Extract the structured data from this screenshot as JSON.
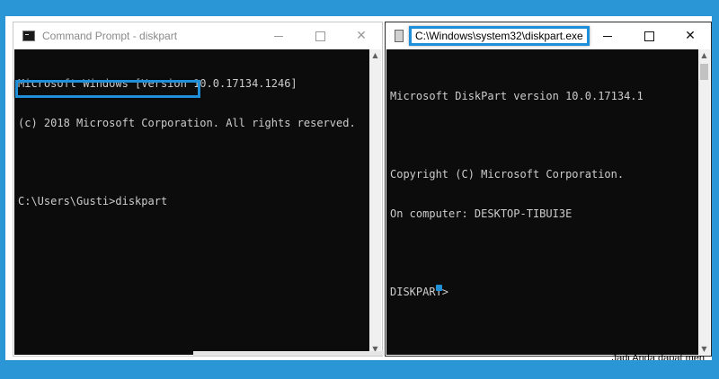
{
  "left_window": {
    "title": "Command Prompt - diskpart",
    "icon": "cmd-icon",
    "controls": [
      "minimize",
      "maximize",
      "close"
    ],
    "lines": [
      "Microsoft Windows [Version 10.0.17134.1246]",
      "(c) 2018 Microsoft Corporation. All rights reserved.",
      "",
      "C:\\Users\\Gusti>diskpart"
    ]
  },
  "right_window": {
    "title": "C:\\Windows\\system32\\diskpart.exe",
    "icon": "diskpart-icon",
    "controls": [
      "minimize",
      "maximize",
      "close"
    ],
    "lines": [
      "Microsoft DiskPart version 10.0.17134.1",
      "",
      "Copyright (C) Microsoft Corporation.",
      "On computer: DESKTOP-TIBUI3E",
      "",
      "DISKPART>"
    ]
  },
  "footer_text": "Jadi Anda dapat men",
  "colors": {
    "frame": "#2a96d6",
    "highlight": "#1f8fd8",
    "console_bg": "#0c0c0c",
    "console_fg": "#cccccc"
  }
}
